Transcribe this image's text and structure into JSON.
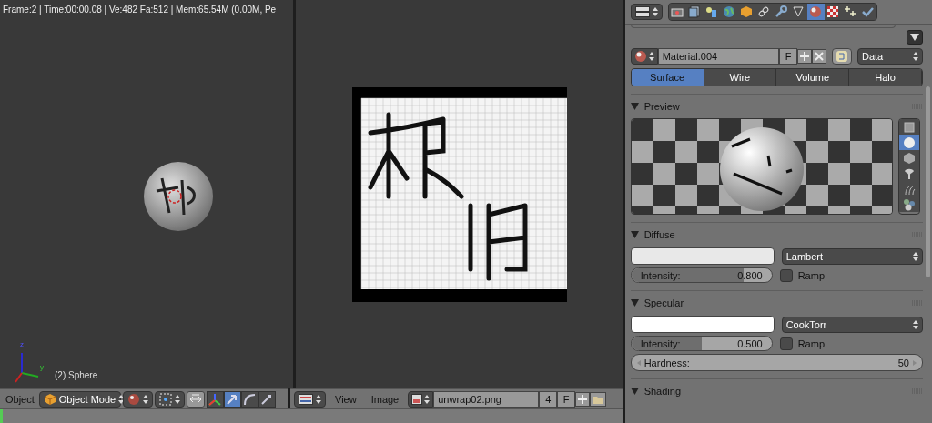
{
  "viewport_3d": {
    "info": "Frame:2 | Time:00:00.08 | Ve:482 Fa:512 | Mem:65.54M (0.00M, Pe",
    "axes": [
      "z",
      "y"
    ],
    "object_label": "(2) Sphere"
  },
  "view3d_header": {
    "menu": "Object",
    "mode": "Object Mode",
    "tools": [
      {
        "kind": "manipulator",
        "selected": false
      },
      {
        "kind": "translate",
        "selected": true
      },
      {
        "kind": "rotate",
        "selected": false
      },
      {
        "kind": "scale",
        "selected": false
      }
    ]
  },
  "image_header": {
    "menus": [
      "View",
      "Image"
    ],
    "image_name": "unwrap02.png",
    "users": "4",
    "fake": "F"
  },
  "properties": {
    "tabs": [
      {
        "kind": "render",
        "selected": false
      },
      {
        "kind": "layers",
        "selected": false
      },
      {
        "kind": "scene",
        "selected": false
      },
      {
        "kind": "world",
        "selected": false
      },
      {
        "kind": "object",
        "selected": false
      },
      {
        "kind": "constraints",
        "selected": false
      },
      {
        "kind": "modifiers",
        "selected": false
      },
      {
        "kind": "data",
        "selected": false
      },
      {
        "kind": "material",
        "selected": true
      },
      {
        "kind": "texture",
        "selected": false
      },
      {
        "kind": "particles",
        "selected": false
      },
      {
        "kind": "physics",
        "selected": false
      }
    ],
    "material": {
      "name": "Material.004",
      "fake": "F",
      "link": "Data"
    },
    "subtabs": [
      {
        "label": "Surface",
        "selected": true
      },
      {
        "label": "Wire",
        "selected": false
      },
      {
        "label": "Volume",
        "selected": false
      },
      {
        "label": "Halo",
        "selected": false
      }
    ],
    "preview": {
      "title": "Preview",
      "expanded": true,
      "shapes": [
        {
          "kind": "plane",
          "selected": false
        },
        {
          "kind": "sphere",
          "selected": true
        },
        {
          "kind": "cube",
          "selected": false
        },
        {
          "kind": "monkey",
          "selected": false
        },
        {
          "kind": "hair",
          "selected": false
        },
        {
          "kind": "spheres",
          "selected": false
        }
      ]
    },
    "diffuse": {
      "title": "Diffuse",
      "expanded": true,
      "color": "#e8e8e8",
      "shader": "Lambert",
      "intensity_label": "Intensity:",
      "intensity": "0.800",
      "level": 0.8,
      "ramp_label": "Ramp",
      "ramp": false
    },
    "specular": {
      "title": "Specular",
      "expanded": true,
      "color": "#ffffff",
      "shader": "CookTorr",
      "intensity_label": "Intensity:",
      "intensity": "0.500",
      "level": 0.5,
      "ramp_label": "Ramp",
      "ramp": false,
      "hardness_label": "Hardness:",
      "hardness": "50"
    },
    "shading": {
      "title": "Shading",
      "expanded": true
    }
  }
}
